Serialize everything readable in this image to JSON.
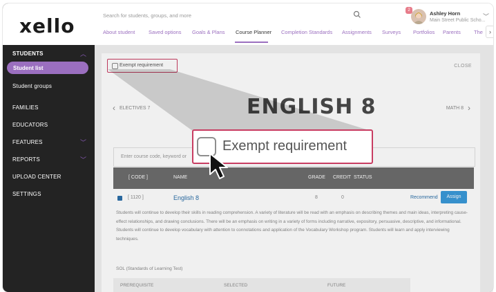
{
  "app": {
    "logo": "xello"
  },
  "sidebar": {
    "sections": [
      {
        "label": "STUDENTS",
        "expanded": true
      },
      {
        "label": "FAMILIES"
      },
      {
        "label": "EDUCATORS"
      },
      {
        "label": "FEATURES",
        "expanded": false
      },
      {
        "label": "REPORTS",
        "expanded": false
      },
      {
        "label": "UPLOAD CENTER"
      },
      {
        "label": "SETTINGS"
      }
    ],
    "sub_items": [
      {
        "label": "Student list",
        "active": true
      },
      {
        "label": "Student groups"
      }
    ]
  },
  "header": {
    "search_placeholder": "Search for students, groups, and more",
    "notification_count": "2",
    "user_name": "Ashley Horn",
    "user_school": "Main Street Public Scho...",
    "tabs": [
      {
        "label": "About student"
      },
      {
        "label": "Saved options"
      },
      {
        "label": "Goals & Plans"
      },
      {
        "label": "Course Planner",
        "active": true
      },
      {
        "label": "Completion Standards"
      },
      {
        "label": "Assignments"
      },
      {
        "label": "Surveys"
      },
      {
        "label": "Portfolios"
      },
      {
        "label": "Parents"
      },
      {
        "label": "The"
      }
    ]
  },
  "course_panel": {
    "exempt_label": "Exempt requirement",
    "close_label": "CLOSE",
    "prev_label": "ELECTIVES 7",
    "next_label": "MATH 8",
    "title": "ENGLISH 8",
    "search_placeholder": "Enter course code, keyword or",
    "columns": {
      "code": "[ CODE ]",
      "name": "NAME",
      "grade": "GRADE",
      "credit": "CREDIT",
      "status": "STATUS"
    },
    "row": {
      "code": "[ 1120 ]",
      "name": "English 8",
      "grade": "8",
      "credit": "0",
      "recommend": "Recommend",
      "assign": "Assign"
    },
    "description": "Students will continue to develop their skills in reading comprehension. A variety of literature will be read with an emphasis on describing themes and main ideas, interpreting cause-effect relationships, and drawing conclusions. There will be an emphasis on writing in a variety of forms including narrative, expository, persuasive, descriptive, and informational. Students will continue to develop vocabulary with attention to connotations and application of the Vocabulary Workshop program. Students will learn and apply interviewing techniques.",
    "sol_label": "SOL (Standards of Learning Test)",
    "prereq_headers": {
      "prerequisite": "PREREQUISITE",
      "selected": "SELECTED",
      "future": "FUTURE"
    }
  },
  "callout": {
    "label": "Exempt requirement"
  },
  "colors": {
    "accent": "#9b6fbf",
    "highlight": "#c83c61",
    "link": "#2c6fa8",
    "button": "#3a9ad9"
  }
}
